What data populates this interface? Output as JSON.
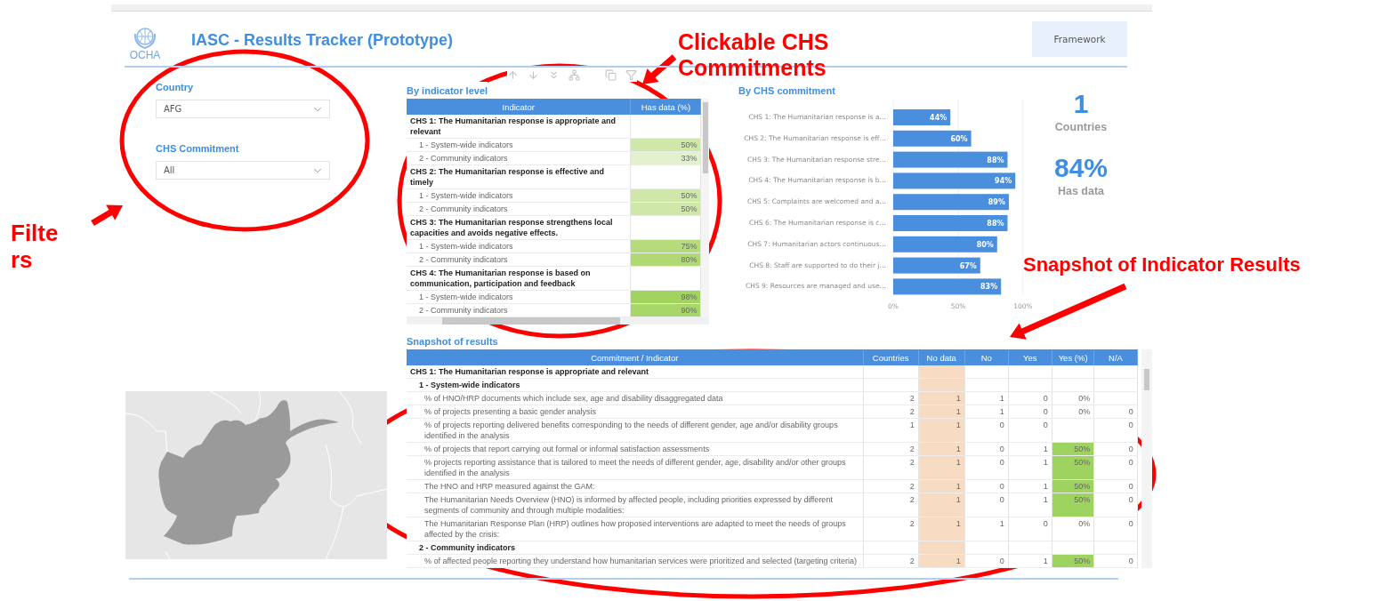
{
  "header": {
    "logo_text": "OCHA",
    "title": "IASC - Results Tracker (Prototype)",
    "button": "Framework"
  },
  "filters": [
    {
      "label": "Country",
      "value": "AFG"
    },
    {
      "label": "CHS Commitment",
      "value": "All"
    }
  ],
  "indicator_table": {
    "title": "By indicator level",
    "columns": [
      "Indicator",
      "Has data (%)"
    ],
    "rows": [
      {
        "kind": "commitment",
        "label": "CHS 1: The Humanitarian response is appropriate and relevant"
      },
      {
        "kind": "group",
        "label": "1 - System-wide indicators",
        "value": "50%",
        "color": "#cfe8a9"
      },
      {
        "kind": "group",
        "label": "2 - Community indicators",
        "value": "33%",
        "color": "#e3f1cf"
      },
      {
        "kind": "commitment",
        "label": "CHS 2: The Humanitarian response is effective and timely"
      },
      {
        "kind": "group",
        "label": "1 - System-wide indicators",
        "value": "50%",
        "color": "#cfe8a9"
      },
      {
        "kind": "group",
        "label": "2 - Community indicators",
        "value": "50%",
        "color": "#cfe8a9"
      },
      {
        "kind": "commitment",
        "label": "CHS 3: The Humanitarian response strengthens local capacities and avoids negative effects."
      },
      {
        "kind": "group",
        "label": "1 - System-wide indicators",
        "value": "75%",
        "color": "#b5db7c"
      },
      {
        "kind": "group",
        "label": "2 - Community indicators",
        "value": "80%",
        "color": "#b0d974"
      },
      {
        "kind": "commitment",
        "label": "CHS 4: The Humanitarian response is based on communication, participation and feedback"
      },
      {
        "kind": "group",
        "label": "1 - System-wide indicators",
        "value": "98%",
        "color": "#a2d35e"
      },
      {
        "kind": "group",
        "label": "2 - Community indicators",
        "value": "90%",
        "color": "#a8d668"
      }
    ]
  },
  "chs_chart": {
    "title": "By CHS commitment",
    "chart_data": {
      "type": "bar",
      "orientation": "horizontal",
      "categories": [
        "CHS 1: The Humanitarian response is a…",
        "CHS 2: The Humanitarian response is eff…",
        "CHS 3: The Humanitarian response stre…",
        "CHS 4: The Humanitarian response is b…",
        "CHS 5: Complaints are welcomed and a…",
        "CHS 6: The Humanitarian response is c…",
        "CHS 7: Humanitarian actors continuous…",
        "CHS 8: Staff are supported to do their j…",
        "CHS 9: Resources are managed and use…"
      ],
      "series": [
        {
          "color": "#4a8fde",
          "values": [
            44,
            60,
            88,
            94,
            89,
            88,
            80,
            67,
            83
          ]
        }
      ],
      "value_labels": [
        "44%",
        "60%",
        "88%",
        "94%",
        "89%",
        "88%",
        "80%",
        "67%",
        "83%"
      ],
      "xlim": [
        0,
        100
      ],
      "xticks": [
        {
          "value": 0,
          "label": "0%"
        },
        {
          "value": 50,
          "label": "50%"
        },
        {
          "value": 100,
          "label": "100%"
        }
      ]
    }
  },
  "cards": [
    {
      "value": "1",
      "label": "Countries"
    },
    {
      "value": "84%",
      "label": "Has data"
    }
  ],
  "snapshot": {
    "title": "Snapshot of results",
    "columns": [
      "Commitment / Indicator",
      "Countries",
      "No data",
      "No",
      "Yes",
      "Yes (%)",
      "N/A"
    ],
    "rows": [
      {
        "kind": "commitment",
        "label": "CHS 1: The Humanitarian response is appropriate and relevant"
      },
      {
        "kind": "group",
        "label": "1 - System-wide indicators"
      },
      {
        "kind": "indicator",
        "label": "% of HNO/HRP documents which include sex, age and disability disaggregated data",
        "countries": "2",
        "no_data": "1",
        "no": "1",
        "yes": "0",
        "yes_pct": "0%",
        "highlight": false
      },
      {
        "kind": "indicator",
        "label": "% of projects presenting a basic gender analysis",
        "countries": "2",
        "no_data": "1",
        "no": "1",
        "yes": "0",
        "yes_pct": "0%",
        "na": "0",
        "highlight": false
      },
      {
        "kind": "indicator",
        "label": "% of projects reporting delivered benefits corresponding to the needs of different gender, age and/or disability groups identified in the analysis",
        "countries": "1",
        "no_data": "1",
        "no": "0",
        "yes": "0",
        "na": "0",
        "highlight": false
      },
      {
        "kind": "indicator",
        "label": "% of projects that report carrying out formal or informal satisfaction assessments",
        "countries": "2",
        "no_data": "1",
        "no": "0",
        "yes": "1",
        "yes_pct": "50%",
        "na": "0",
        "highlight": true
      },
      {
        "kind": "indicator",
        "label": "% projects reporting assistance that is tailored to meet the needs of different gender, age, disability and/or other groups identified in the analysis",
        "countries": "2",
        "no_data": "1",
        "no": "0",
        "yes": "1",
        "yes_pct": "50%",
        "na": "0",
        "highlight": true
      },
      {
        "kind": "indicator",
        "label": "The HNO and HRP measured against the GAM:",
        "countries": "2",
        "no_data": "1",
        "no": "0",
        "yes": "1",
        "yes_pct": "50%",
        "na": "0",
        "highlight": true
      },
      {
        "kind": "indicator",
        "label": "The Humanitarian Needs Overview (HNO) is informed by affected people, including priorities expressed by different segments of community and through multiple modalities:",
        "countries": "2",
        "no_data": "1",
        "no": "0",
        "yes": "1",
        "yes_pct": "50%",
        "na": "0",
        "highlight": true
      },
      {
        "kind": "indicator",
        "label": "The Humanitarian Response Plan (HRP) outlines how proposed interventions are adapted to meet the needs of groups affected by the crisis:",
        "countries": "2",
        "no_data": "1",
        "no": "1",
        "yes": "0",
        "yes_pct": "0%",
        "na": "0",
        "highlight": false
      },
      {
        "kind": "group",
        "label": "2 - Community indicators"
      },
      {
        "kind": "indicator",
        "label": "% of affected people reporting they understand how humanitarian services were prioritized and selected (targeting criteria)",
        "countries": "2",
        "no_data": "1",
        "no": "0",
        "yes": "1",
        "yes_pct": "50%",
        "na": "0",
        "highlight": true
      }
    ]
  },
  "annotations": [
    {
      "text": "Clickable CHS Commitments"
    },
    {
      "text": "Filters"
    },
    {
      "text": "Snapshot of Indicator Results"
    }
  ]
}
